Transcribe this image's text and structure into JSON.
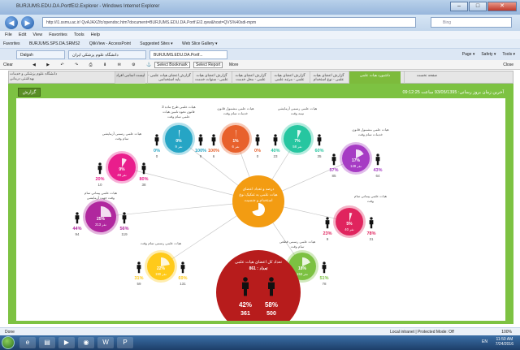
{
  "window": {
    "title": "BURJUMS.EDU.DA.PortfEI2.Explorer - Windows Internet Explorer",
    "close_symbol": "✕",
    "min_symbol": "–",
    "max_symbol": "□"
  },
  "address": {
    "url": "http://i1.ssmu.ac.ir/ QvAJAXZfc/opendoc.htm?document=BURJUMS.EDU.DA.Portf.EI2.qvw&host=QVS%40sdi-mpm",
    "search_placeholder": "Bing"
  },
  "menu": [
    "File",
    "Edit",
    "View",
    "Favorites",
    "Tools",
    "Help"
  ],
  "favorites": [
    "Favorites",
    "BURJUMS.SPS.DA.SRMS2",
    "QlikView - AccessPoint",
    "Suggested Sites ▾",
    "Web Slice Gallery ▾"
  ],
  "ie_tabs": [
    "Dalgah",
    "دانشگاه علوم پزشکی ایران",
    "BURJUMS.EDU.DA.Portf..."
  ],
  "command_bar": [
    "Page ▾",
    "Safety ▾",
    "Tools ▾"
  ],
  "report_bar": {
    "clear": "Clear",
    "bookmark": "Select Bookmark",
    "report": "Select Report",
    "more": "More",
    "close": "Close"
  },
  "app_tabs": [
    {
      "label": "صفحه نخست",
      "state": "normal"
    },
    {
      "label": "داشبورد هیات علمی",
      "state": "active"
    },
    {
      "label": "گزارش اعضای هیات علمی - نوع استخدام",
      "state": "normal"
    },
    {
      "label": "گزارش اعضای هیات علمی - مرتبه علمی",
      "state": "normal"
    },
    {
      "label": "گزارش اعضای هیات علمی - محل خدمت",
      "state": "normal"
    },
    {
      "label": "گزارش اعضای هیات علمی - سنوات خدمت",
      "state": "normal"
    },
    {
      "label": "گزارش اعضای هیات علمی - پایه استخدامی",
      "state": "normal"
    },
    {
      "label": "لیست اسامی افراد",
      "state": "dim"
    }
  ],
  "logo_text": "دانشگاه علوم پزشکی و خدمات بهداشتی درمانی",
  "report_button": "گزارش",
  "datetime": "آخرین زمان بروز رسانی: 93/05/1395 ساعت 09:12:25",
  "center": {
    "text": "درصد و تعداد اعضای هیات علمی به تفکیک نوع استخدام و جنسیت",
    "color": "#f39c12"
  },
  "total": {
    "title": "تعداد کل اعضای هیات علمی",
    "count_label": "تعداد : 861",
    "female_pct": "42%",
    "male_pct": "58%",
    "female_n": "361",
    "male_n": "500",
    "color": "#b71c1c"
  },
  "nodes": [
    {
      "label": "هیات علمی رسمی آزمایشی تمام وقت",
      "pct": "9%",
      "n": "48",
      "pctL": "20%",
      "pctR": "80%",
      "nL": "10",
      "nR": "38",
      "color": "#e91e8c",
      "angle": 0.09
    },
    {
      "label": "هیات علمی طرح ماده 3 قانون نحوه تامین هیات علمی تمام وقت",
      "pct": "0%",
      "n": "9",
      "pctL": "0%",
      "pctR": "100%",
      "nL": "0",
      "nR": "9",
      "color": "#26a5c5",
      "angle": 0.02
    },
    {
      "label": "هیات علمی مشمول قانون خدمات تمام وقت",
      "pct": "1%",
      "n": "6",
      "pctL": "100%",
      "pctR": "0%",
      "nL": "6",
      "nR": "0",
      "color": "#e8612c",
      "angle": 0.01
    },
    {
      "label": "هیات علمی رسمی آزمایشی نیمه وقت",
      "pct": "7%",
      "n": "58",
      "pctL": "40%",
      "pctR": "60%",
      "nL": "23",
      "nR": "35",
      "color": "#26c6a0",
      "angle": 0.07
    },
    {
      "label": "هیات علمی مشمول قانون خدمات تمام وقت",
      "pct": "17%",
      "n": "149",
      "pctL": "57%",
      "pctR": "43%",
      "nL": "85",
      "nR": "64",
      "color": "#a63bc4",
      "angle": 0.17
    },
    {
      "label": "هیات علمی پیمانی تمام وقت",
      "pct": "5%",
      "n": "40",
      "pctL": "23%",
      "pctR": "78%",
      "nL": "9",
      "nR": "31",
      "color": "#e0245e",
      "angle": 0.05
    },
    {
      "label": "هیات علمی رسمی قطعی تمام وقت",
      "pct": "18%",
      "n": "153",
      "pctL": "49%",
      "pctR": "51%",
      "nL": "75",
      "nR": "78",
      "color": "#7cc142",
      "angle": 0.18
    },
    {
      "label": "هیات علمی رسمی تمام وقت",
      "pct": "22%",
      "n": "190",
      "pctL": "31%",
      "pctR": "69%",
      "nL": "59",
      "nR": "131",
      "color": "#ffca1a",
      "angle": 0.22
    },
    {
      "label": "هیات علمی پیمانی تمام وقت جهت آزمایشی",
      "pct": "25%",
      "n": "213",
      "pctL": "44%",
      "pctR": "56%",
      "nL": "94",
      "nR": "119",
      "color": "#b0279e",
      "angle": 0.25
    }
  ],
  "status": {
    "left": "Done",
    "zone": "Local intranet | Protected Mode: Off",
    "zoom": "100%"
  },
  "taskbar": {
    "time": "11:50 AM",
    "date": "7/24/2016",
    "lang": "EN"
  }
}
